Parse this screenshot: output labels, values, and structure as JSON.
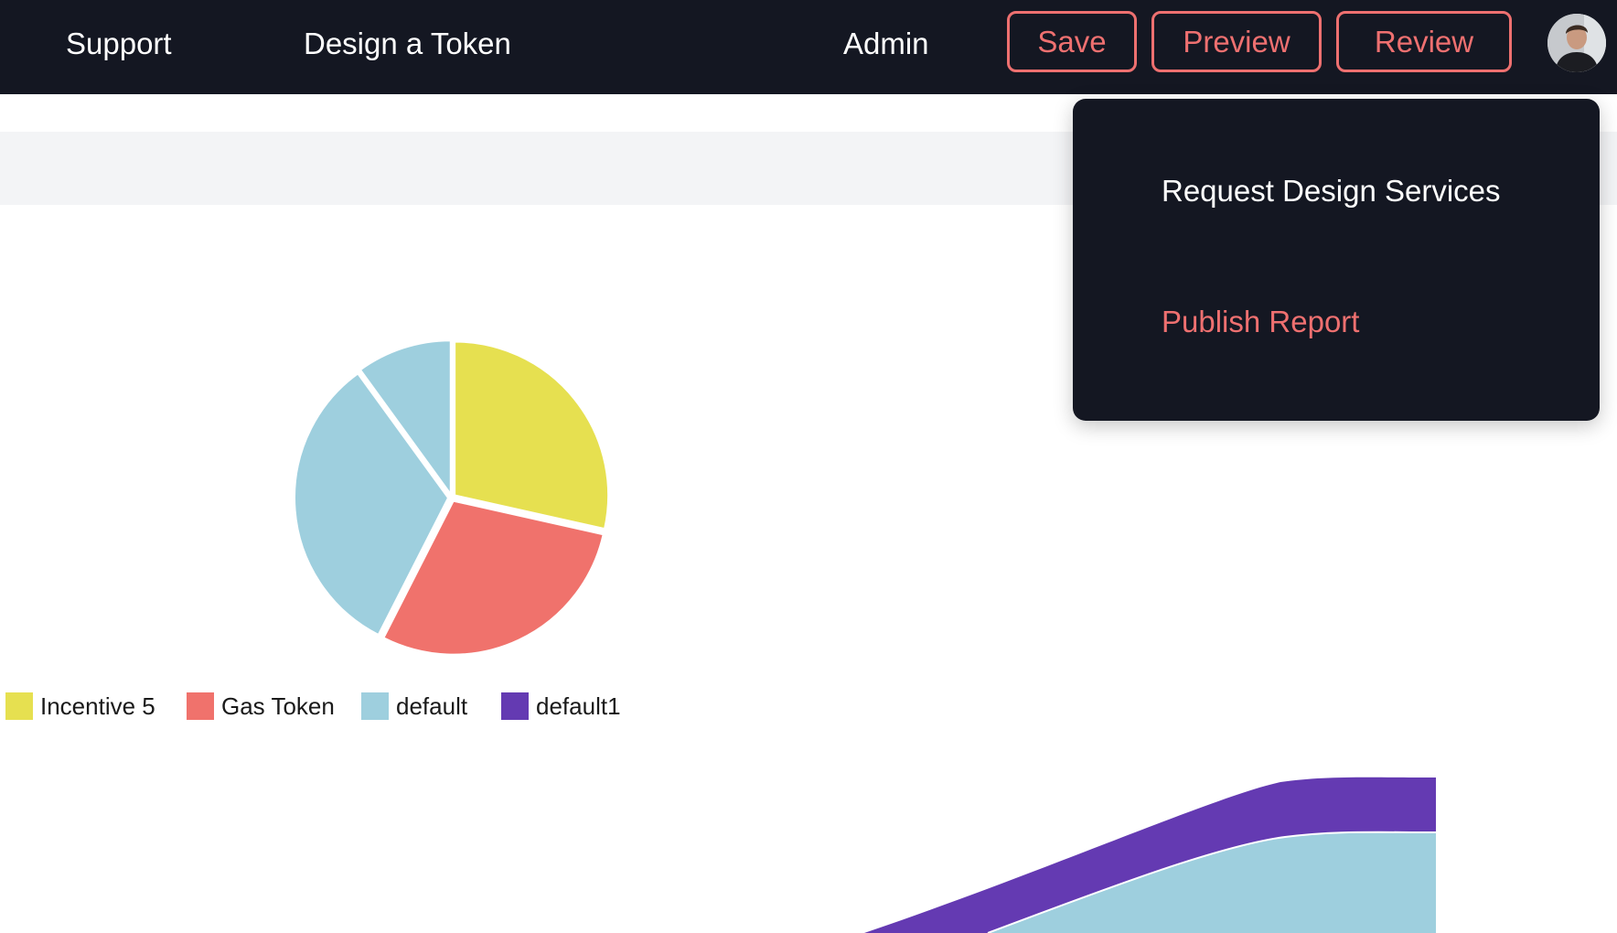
{
  "nav": {
    "links": [
      {
        "label": "Support"
      },
      {
        "label": "Design a Token"
      },
      {
        "label": "Admin"
      }
    ],
    "buttons": [
      {
        "label": "Save"
      },
      {
        "label": "Preview"
      },
      {
        "label": "Review"
      }
    ]
  },
  "dropdown": {
    "items": [
      {
        "label": "Request Design Services"
      },
      {
        "label": "Publish Report"
      }
    ]
  },
  "colors": {
    "nav_bg": "#141722",
    "accent": "#ee7070",
    "series_1": "#e6e050",
    "series_2": "#f0726c",
    "series_3": "#9ecfde",
    "series_4": "#643ab2"
  },
  "chart_data": [
    {
      "type": "pie",
      "legend_position": "bottom-left",
      "slices": [
        {
          "label": "Incentive 5",
          "value": 28.5,
          "color": "#e6e050"
        },
        {
          "label": "Gas Token",
          "value": 29,
          "color": "#f0726c"
        },
        {
          "label": "default",
          "value": 32.5,
          "color": "#9ecfde"
        },
        {
          "label": "default",
          "value": 10,
          "color": "#9ecfde"
        }
      ],
      "legend": [
        {
          "label": "Incentive 5",
          "color": "#e6e050"
        },
        {
          "label": "Gas Token",
          "color": "#f0726c"
        },
        {
          "label": "default",
          "color": "#9ecfde"
        },
        {
          "label": "default1",
          "color": "#643ab2"
        }
      ]
    },
    {
      "type": "area",
      "note_visible_portion": "partially visible stacked area, cut off at bottom edge",
      "series": [
        {
          "name": "default",
          "color": "#9ecfde"
        },
        {
          "name": "default1",
          "color": "#643ab2"
        }
      ]
    }
  ]
}
